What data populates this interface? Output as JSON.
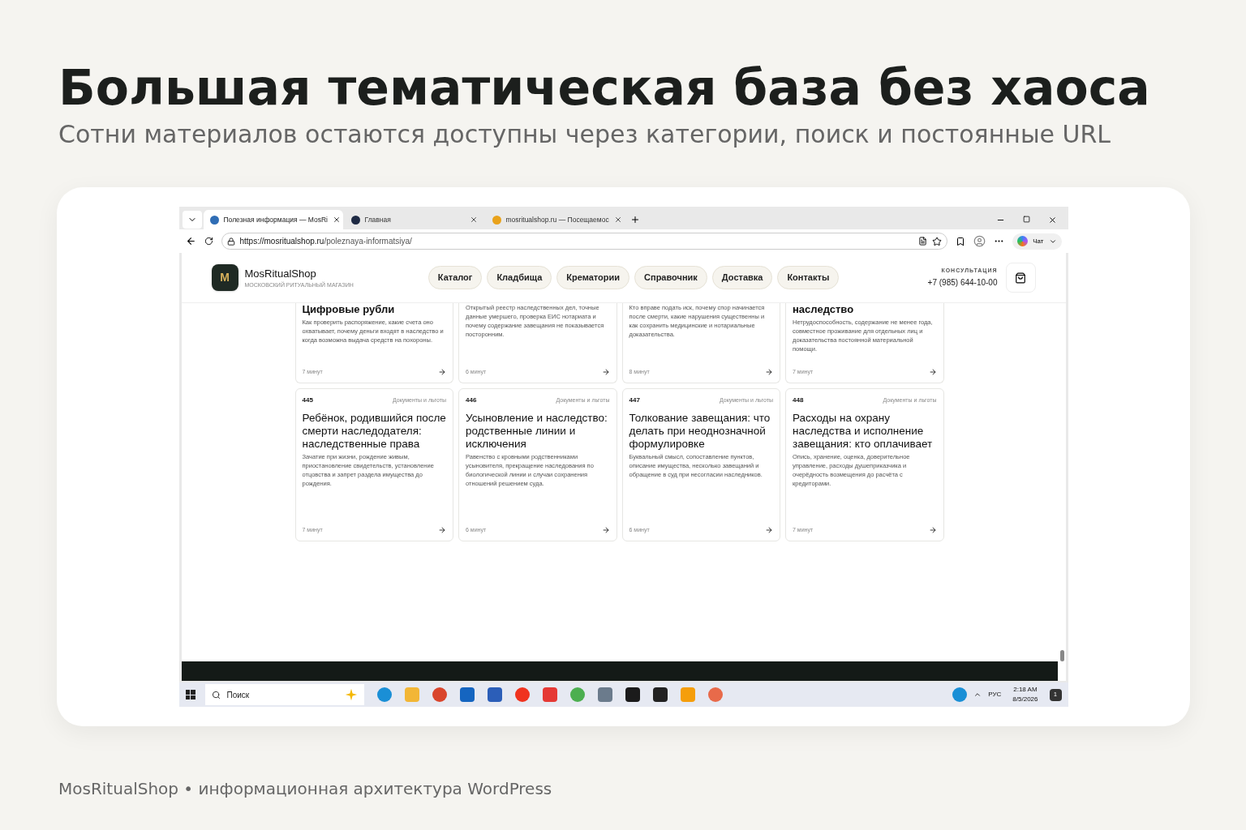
{
  "slide": {
    "title": "Большая тематическая база без хаоса",
    "subtitle": "Сотни материалов остаются доступны через категории, поиск и постоянные URL",
    "footer": "MosRitualShop • информационная архитектура WordPress"
  },
  "browser": {
    "tabs": [
      {
        "title": "Полезная информация — MosRi",
        "selected": true
      },
      {
        "title": "Главная",
        "selected": false
      },
      {
        "title": "mosritualshop.ru — Посещаемос",
        "selected": false
      }
    ],
    "url_host": "https://mosritualshop.ru",
    "url_path": "/poleznaya-informatsiya/",
    "chat": "Чат"
  },
  "site": {
    "logo_letter": "M",
    "name": "MosRitualShop",
    "tagline": "МОСКОВСКИЙ РИТУАЛЬНЫЙ МАГАЗИН",
    "nav": [
      "Каталог",
      "Кладбища",
      "Крематории",
      "Справочник",
      "Доставка",
      "Контакты"
    ],
    "consult_label": "КОНСУЛЬТАЦИЯ",
    "phone": "+7 (985) 644-10-00"
  },
  "partial_articles": [
    {
      "title": "Цифровые рубли",
      "description": "Как проверить распоряжение, какие счета оно охватывает, почему деньги входят в наследство и когда возможна выдача средств на похороны.",
      "time": "7 минут"
    },
    {
      "description": "Открытый реестр наследственных дел, точные данные умершего, проверка ЕИС нотариата и почему содержание завещания не показывается посторонним.",
      "time": "6 минут"
    },
    {
      "description": "Кто вправе подать иск, почему спор начинается после смерти, какие нарушения существенны и как сохранить медицинские и нотариальные доказательства.",
      "time": "8 минут"
    },
    {
      "title": "наследство",
      "description": "Нетрудоспособность, содержание не менее года, совместное проживание для отдельных лиц и доказательства постоянной материальной помощи.",
      "time": "7 минут"
    }
  ],
  "articles": [
    {
      "number": "445",
      "category": "Документы и льготы",
      "title": "Ребёнок, родившийся после смерти наследодателя: наследственные права",
      "description": "Зачатие при жизни, рождение живым, приостановление свидетельств, установление отцовства и запрет раздела имущества до рождения.",
      "time": "7 минут"
    },
    {
      "number": "446",
      "category": "Документы и льготы",
      "title": "Усыновление и наследство: родственные линии и исключения",
      "description": "Равенство с кровными родственниками усыновителя, прекращение наследования по биологической линии и случаи сохранения отношений решением суда.",
      "time": "6 минут"
    },
    {
      "number": "447",
      "category": "Документы и льготы",
      "title": "Толкование завещания: что делать при неоднозначной формулировке",
      "description": "Буквальный смысл, сопоставление пунктов, описание имущества, несколько завещаний и обращение в суд при несогласии наследников.",
      "time": "6 минут"
    },
    {
      "number": "448",
      "category": "Документы и льготы",
      "title": "Расходы на охрану наследства и исполнение завещания: кто оплачивает",
      "description": "Опись, хранение, оценка, доверительное управление, расходы душеприказчика и очерёдность возмещения до расчёта с кредиторами.",
      "time": "7 минут"
    }
  ],
  "taskbar": {
    "search": "Поиск",
    "language": "РУС",
    "time": "2:18 AM",
    "date": "8/5/2026",
    "notifications": "1"
  }
}
